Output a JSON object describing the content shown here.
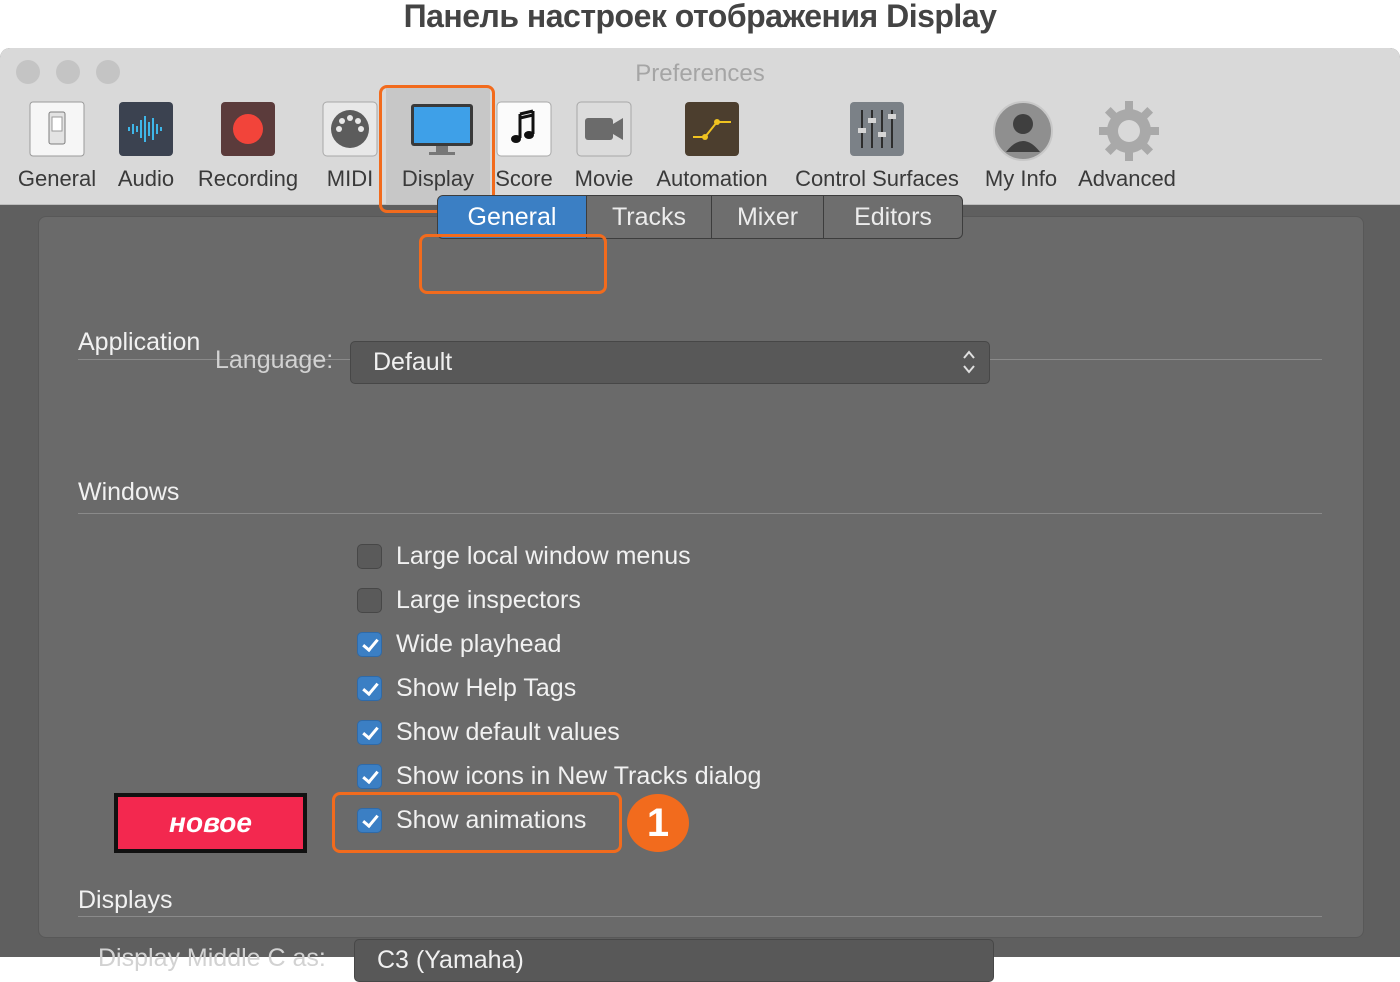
{
  "caption": "Панель настроек отображения Display",
  "window": {
    "title": "Preferences"
  },
  "toolbar": {
    "items": [
      {
        "label": "General",
        "icon": "general-switch-icon"
      },
      {
        "label": "Audio",
        "icon": "audio-waveform-icon"
      },
      {
        "label": "Recording",
        "icon": "record-icon"
      },
      {
        "label": "MIDI",
        "icon": "midi-connector-icon"
      },
      {
        "label": "Display",
        "icon": "display-monitor-icon",
        "selected": true
      },
      {
        "label": "Score",
        "icon": "music-note-icon"
      },
      {
        "label": "Movie",
        "icon": "movie-camera-icon"
      },
      {
        "label": "Automation",
        "icon": "automation-curve-icon"
      },
      {
        "label": "Control Surfaces",
        "icon": "control-faders-icon"
      },
      {
        "label": "My Info",
        "icon": "user-silhouette-icon"
      },
      {
        "label": "Advanced",
        "icon": "gear-icon"
      }
    ]
  },
  "tabs": [
    "General",
    "Tracks",
    "Mixer",
    "Editors"
  ],
  "active_tab": "General",
  "sections": {
    "application": "Application",
    "windows": "Windows",
    "displays": "Displays"
  },
  "language": {
    "label": "Language:",
    "value": "Default"
  },
  "checkboxes": [
    {
      "label": "Large local window menus",
      "checked": false
    },
    {
      "label": "Large inspectors",
      "checked": false
    },
    {
      "label": "Wide playhead",
      "checked": true
    },
    {
      "label": "Show Help Tags",
      "checked": true
    },
    {
      "label": "Show default values",
      "checked": true
    },
    {
      "label": "Show icons in New Tracks dialog",
      "checked": true
    },
    {
      "label": "Show animations",
      "checked": true
    }
  ],
  "annotations": {
    "new_badge": "новое",
    "step_number": "1"
  },
  "displays_row": {
    "label": "Display Middle C as:",
    "value": "C3 (Yamaha)"
  },
  "colors": {
    "accent": "#3b7fc4",
    "highlight": "#f26b1d",
    "new_badge": "#f3284f"
  }
}
